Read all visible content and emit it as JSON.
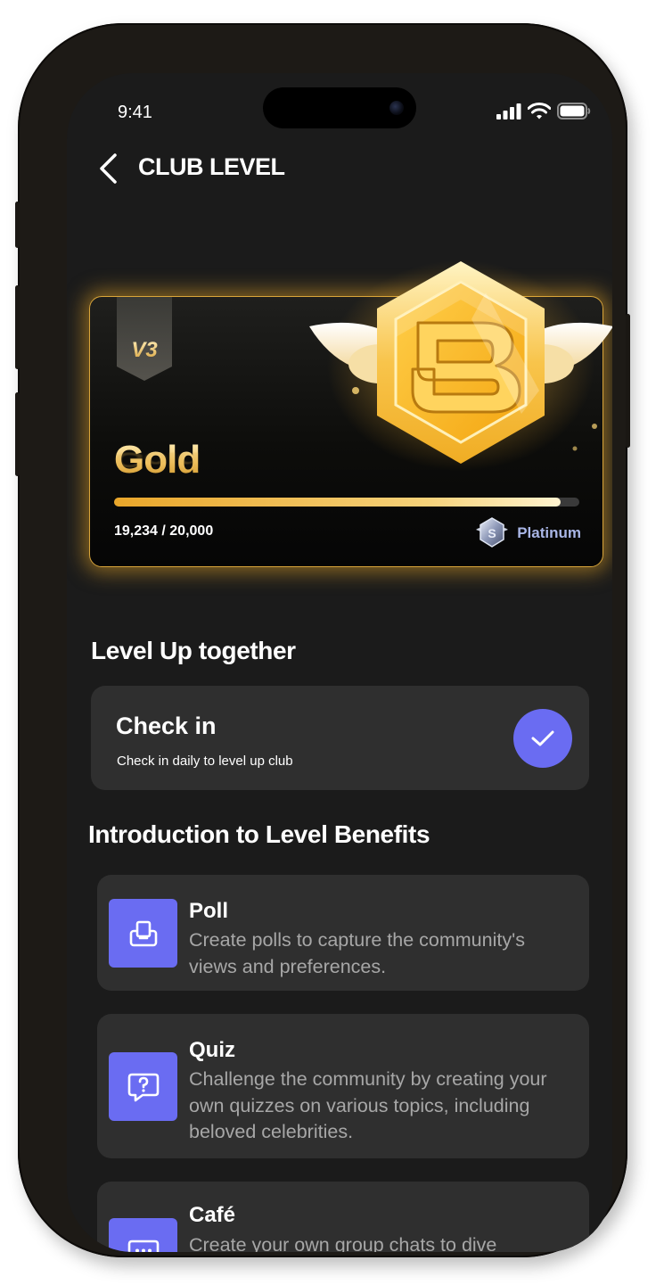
{
  "status_bar": {
    "time": "9:41"
  },
  "header": {
    "title": "CLUB LEVEL"
  },
  "level_card": {
    "rank_badge": "V3",
    "tier": "Gold",
    "points": "19,234 / 20,000",
    "progress": 0.96,
    "next_tier": "Platinum"
  },
  "level_up": {
    "section_title": "Level Up together",
    "checkin": {
      "title": "Check in",
      "subtitle": "Check in daily to level up club",
      "completed": true
    }
  },
  "benefits": {
    "section_title": "Introduction to Level Benefits",
    "items": [
      {
        "title": "Poll",
        "description": "Create polls to capture the community's views and preferences.",
        "icon": "poll-icon"
      },
      {
        "title": "Quiz",
        "description": "Challenge the community by creating your own quizzes on various topics, including beloved celebrities.",
        "icon": "quiz-icon"
      },
      {
        "title": "Café",
        "description": "Create your own group chats to dive",
        "icon": "chat-icon"
      }
    ]
  },
  "colors": {
    "accent": "#6a6cf2",
    "gold": "#f2c462",
    "card": "#2f2f2f",
    "background": "#1b1b1b"
  }
}
